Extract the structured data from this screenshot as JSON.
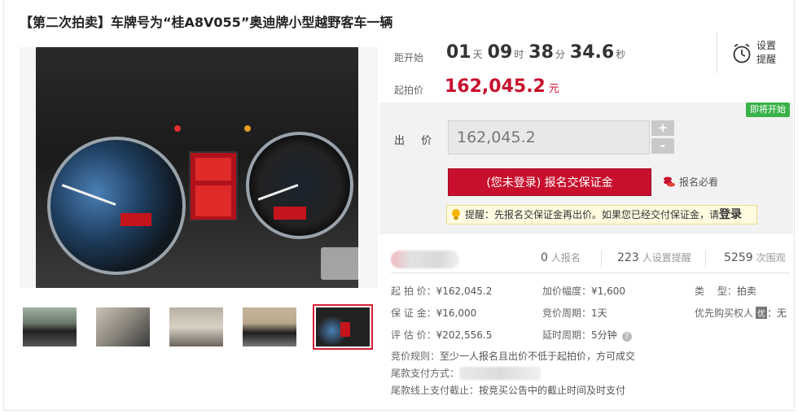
{
  "title": "【第二次拍卖】车牌号为“桂A8V055”奥迪牌小型越野客车一辆",
  "countdown": {
    "label": "距开始",
    "days": "01",
    "days_unit": "天",
    "hours": "09",
    "hours_unit": "时",
    "minutes": "38",
    "minutes_unit": "分",
    "seconds": "34.6",
    "seconds_unit": "秒"
  },
  "reminder": {
    "label": "设置提醒",
    "icon": "alarm-clock-icon"
  },
  "start_price": {
    "label": "起拍价",
    "value": "162,045.2",
    "unit": "元"
  },
  "bid": {
    "badge": "即将开始",
    "label": "出 价",
    "input_value": "162,045.2",
    "plus": "+",
    "minus": "-",
    "deposit_button": "(您未登录) 报名交保证金",
    "must_read": "报名必看",
    "tip_text": "提醒：先报名交保证金再出价。如果您已经交付保证金，请",
    "tip_login": "登录"
  },
  "stats": {
    "signup_count": "0",
    "signup_label": "人报名",
    "reminder_count": "223",
    "reminder_label": "人设置提醒",
    "views_count": "5259",
    "views_label": "次围观"
  },
  "details": {
    "start_price": {
      "k": "起 拍 价：",
      "v": "¥162,045.2"
    },
    "increment": {
      "k": "加价幅度：",
      "v": "¥1,600"
    },
    "type": {
      "k": "类　 型：",
      "v": "拍卖"
    },
    "deposit": {
      "k": "保 证 金：",
      "v": "¥16,000"
    },
    "cycle": {
      "k": "竞价周期：",
      "v": "1天"
    },
    "priority": {
      "k": "优先购买权人",
      "tag": "优",
      "v": "：无"
    },
    "valuation": {
      "k": "评 估 价：",
      "v": "¥202,556.5"
    },
    "delay": {
      "k": "延时周期：",
      "v": "5分钟"
    },
    "rule": {
      "k": "竞价规则：",
      "v": "至少一人报名且出价不低于起拍价，方可成交"
    },
    "payment": {
      "k": "尾款支付方式："
    },
    "deadline": {
      "k": "尾款线上支付截止：",
      "v": "按竞买公告中的截止时间及时支付"
    }
  },
  "gallery": {
    "thumbnails": [
      "exterior-front",
      "interior-front-seats",
      "interior-rear-seats",
      "exterior-rear",
      "dashboard"
    ],
    "active_index": 4
  },
  "colors": {
    "accent_red": "#c8102e",
    "badge_green": "#3ab24a",
    "tip_bg": "#fffbe0"
  }
}
